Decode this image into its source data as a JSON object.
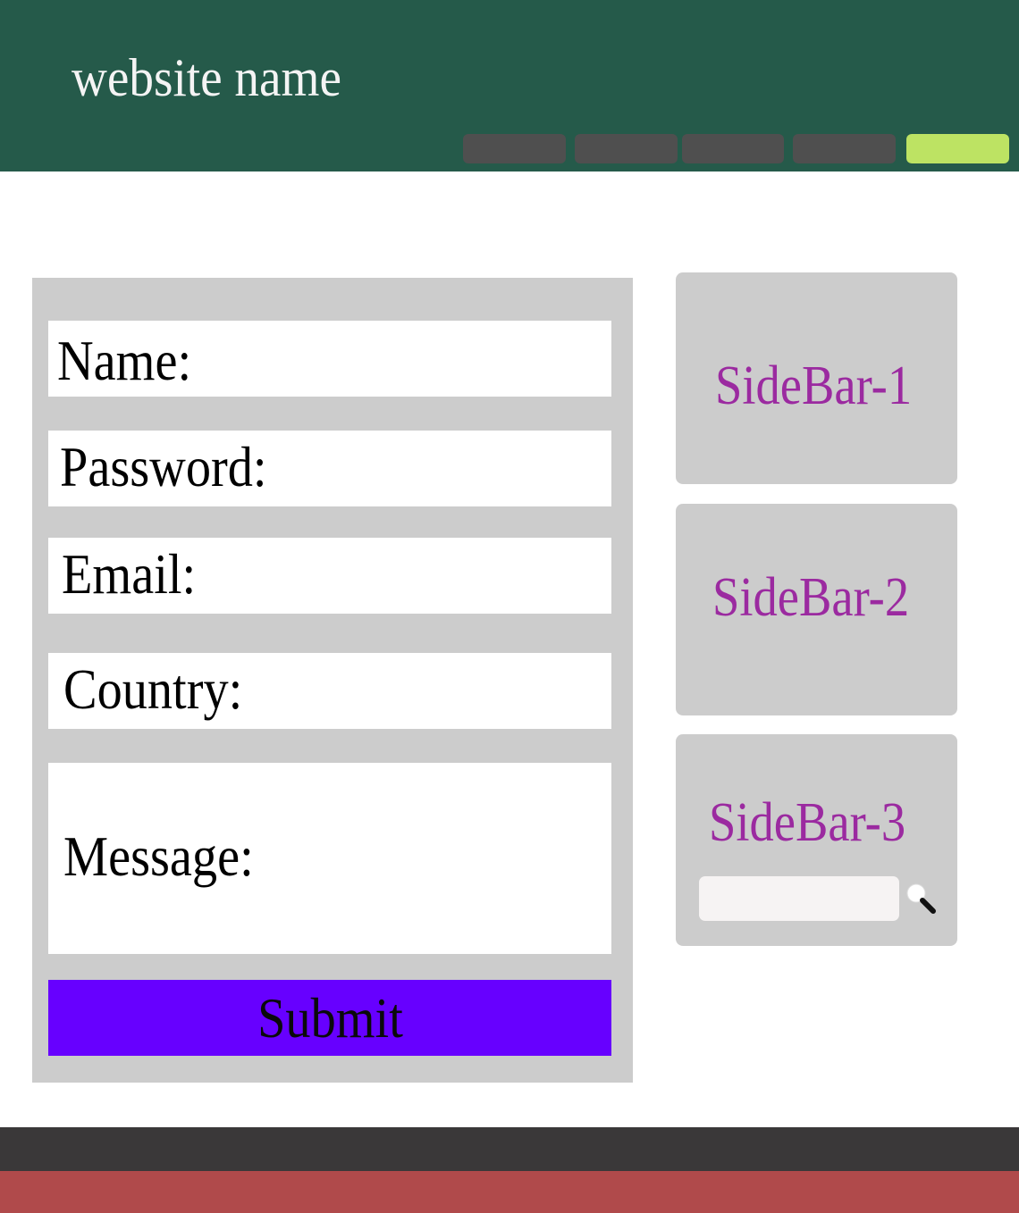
{
  "header": {
    "site_name": "website name",
    "nav_items": [
      {
        "label": "",
        "active": false
      },
      {
        "label": "",
        "active": false
      },
      {
        "label": "",
        "active": false
      },
      {
        "label": "",
        "active": false
      },
      {
        "label": "",
        "active": true
      }
    ]
  },
  "form": {
    "fields": {
      "name": {
        "label": "Name:"
      },
      "password": {
        "label": "Password:"
      },
      "email": {
        "label": "Email:"
      },
      "country": {
        "label": "Country:"
      },
      "message": {
        "label": "Message:"
      }
    },
    "submit_label": "Submit"
  },
  "sidebars": [
    {
      "title": "SideBar-1"
    },
    {
      "title": "SideBar-2"
    },
    {
      "title": "SideBar-3",
      "search": {
        "value": "",
        "placeholder": ""
      }
    }
  ],
  "colors": {
    "header_bg": "#255a4a",
    "nav_button": "#4f4f4f",
    "nav_active": "#bde363",
    "panel_bg": "#cccccc",
    "submit_bg": "#6700ff",
    "sidebar_title": "#9b2aa0",
    "footer_top": "#3a3839",
    "footer_bottom": "#b04a4b"
  },
  "icons": {
    "search": "magnifier-icon"
  }
}
